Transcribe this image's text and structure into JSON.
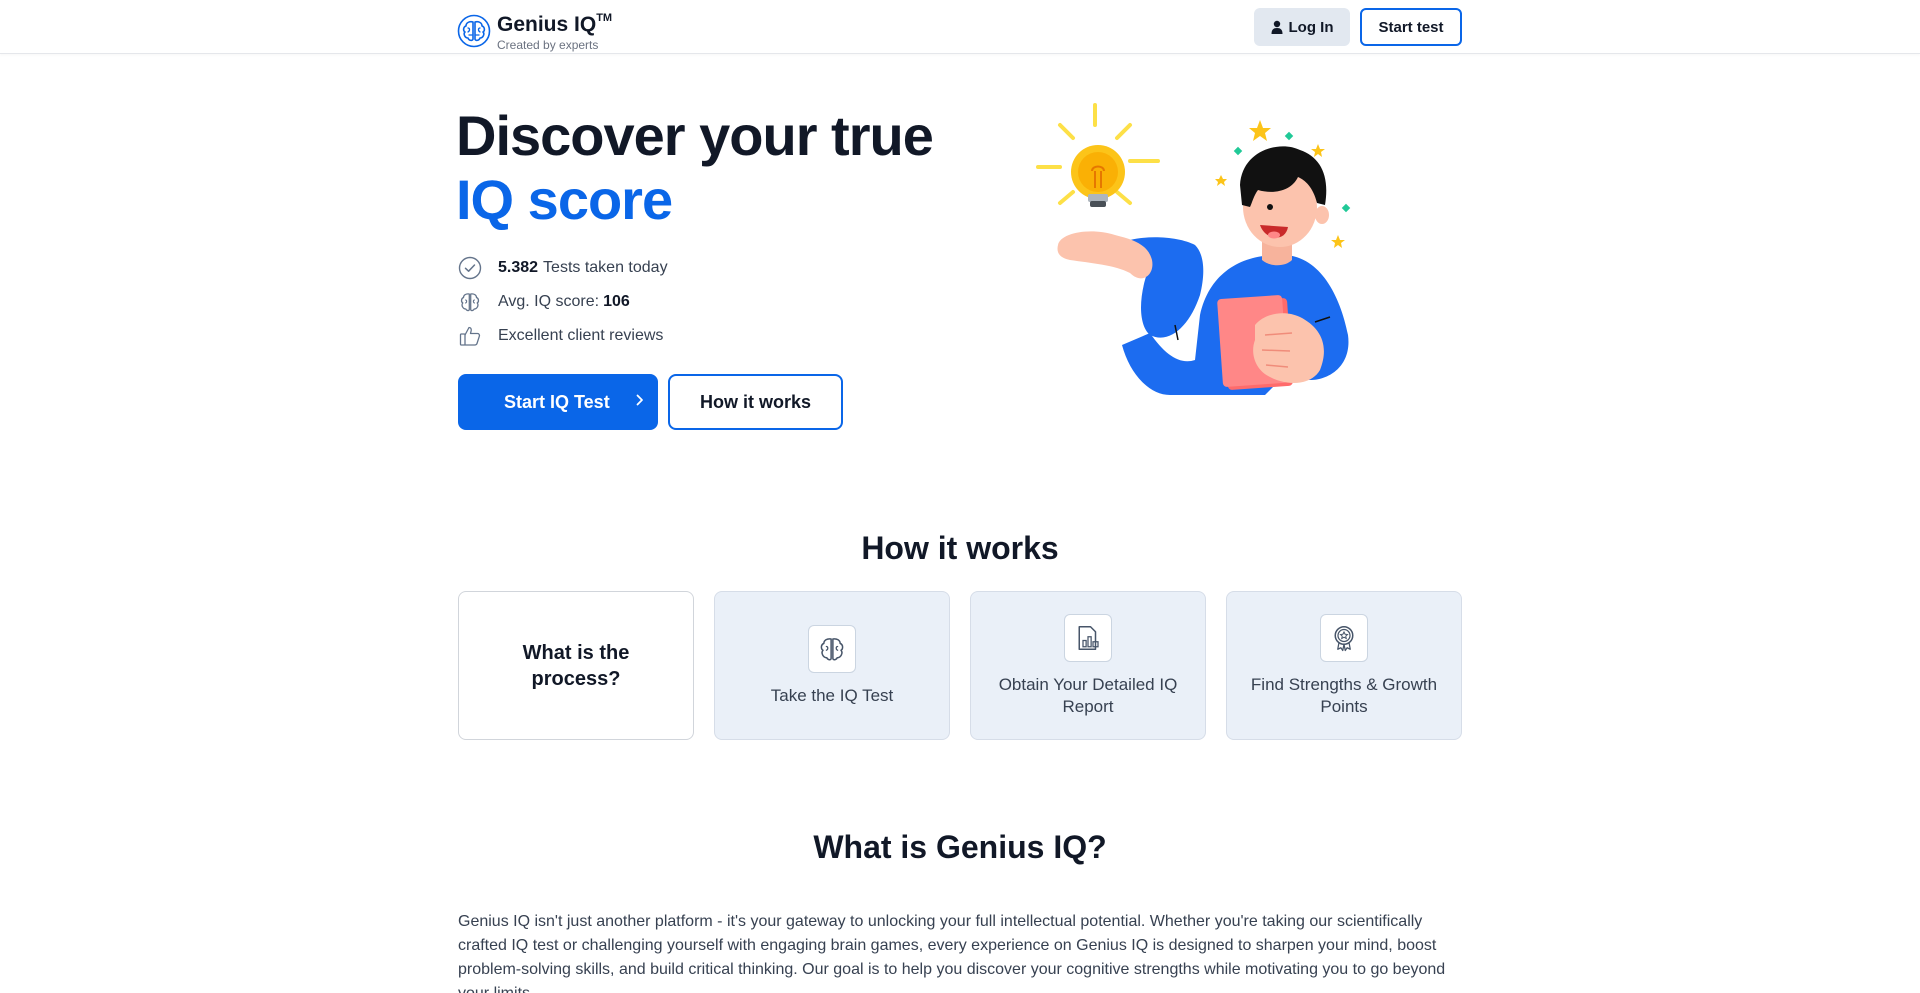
{
  "header": {
    "brand": "Genius IQ",
    "brand_mark": "TM",
    "tagline": "Created by experts",
    "login_label": "Log In",
    "start_label": "Start test"
  },
  "hero": {
    "title_line1": "Discover your true",
    "title_line2": "IQ score",
    "stats": {
      "tests_count": "5.382",
      "tests_label": "Tests taken today",
      "avg_label": "Avg. IQ score:",
      "avg_value": "106",
      "reviews_label": "Excellent client reviews"
    },
    "primary_cta": "Start IQ Test",
    "secondary_cta": "How it works"
  },
  "how": {
    "title": "How it works",
    "intro": "What is the process?",
    "steps": [
      {
        "label": "Take the IQ Test",
        "icon": "brain-icon"
      },
      {
        "label": "Obtain Your Detailed IQ Report",
        "icon": "report-chart-icon"
      },
      {
        "label": "Find Strengths & Growth Points",
        "icon": "award-badge-icon"
      }
    ]
  },
  "about": {
    "title": "What is Genius IQ?",
    "text": "Genius IQ isn't just another platform - it's your gateway to unlocking your full intellectual potential. Whether you're taking our scientifically crafted IQ test or challenging yourself with engaging brain games, every experience on Genius IQ is designed to sharpen your mind, boost problem-solving skills, and build critical thinking. Our goal is to help you discover your cognitive strengths while motivating you to go beyond your limits."
  },
  "colors": {
    "accent": "#0a66e8",
    "text": "#111827",
    "card_bg": "#eaf0f8"
  }
}
